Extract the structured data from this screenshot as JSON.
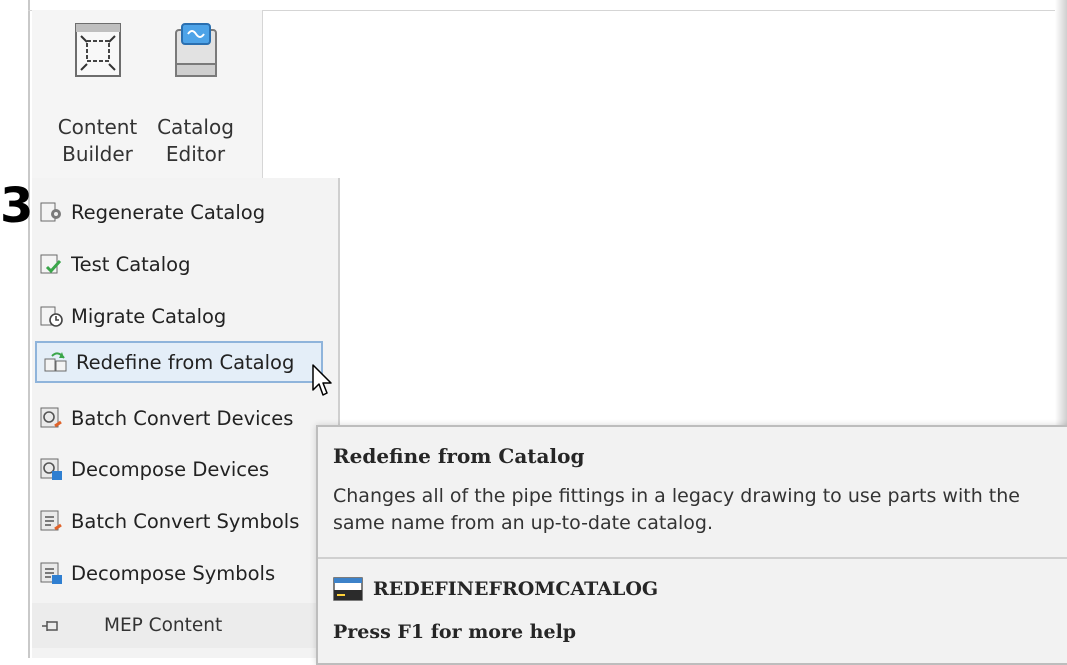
{
  "step_marker": "3",
  "ribbon": {
    "buttons": [
      {
        "label_line1": "Content",
        "label_line2": "Builder",
        "icon": "content-builder-icon"
      },
      {
        "label_line1": "Catalog",
        "label_line2": "Editor",
        "icon": "catalog-editor-icon"
      }
    ]
  },
  "menu": {
    "items": [
      {
        "label": "Regenerate Catalog",
        "icon": "regenerate-catalog-icon"
      },
      {
        "label": "Test Catalog",
        "icon": "test-catalog-icon"
      },
      {
        "label": "Migrate Catalog",
        "icon": "migrate-catalog-icon"
      },
      {
        "label": "Redefine from Catalog",
        "icon": "redefine-from-catalog-icon",
        "highlighted": true
      },
      {
        "label": "Batch Convert Devices",
        "icon": "batch-convert-devices-icon"
      },
      {
        "label": "Decompose Devices",
        "icon": "decompose-devices-icon"
      },
      {
        "label": "Batch Convert Symbols",
        "icon": "batch-convert-symbols-icon"
      },
      {
        "label": "Decompose Symbols",
        "icon": "decompose-symbols-icon"
      }
    ],
    "footer_label": "MEP Content",
    "footer_icon": "pin-icon"
  },
  "tooltip": {
    "title": "Redefine from Catalog",
    "description": "Changes all of the pipe fittings in a legacy drawing to use parts with the same name from an up-to-date catalog.",
    "command": "REDEFINEFROMCATALOG",
    "help": "Press F1 for more help"
  },
  "colors": {
    "highlight_bg": "#e4eef8",
    "highlight_border": "#8fb4db",
    "panel_bg": "#f3f3f3"
  }
}
